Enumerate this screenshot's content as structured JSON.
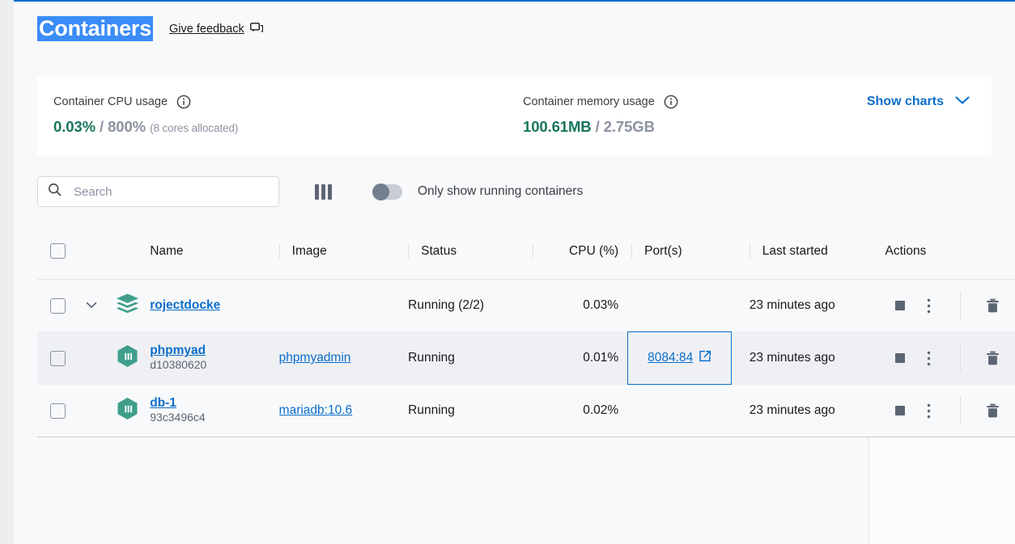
{
  "header": {
    "title": "Containers",
    "feedback_label": "Give feedback",
    "feedback_icon": "feedback-chat-icon"
  },
  "stats": {
    "cpu": {
      "label": "Container CPU usage",
      "info_icon": "info-icon",
      "used": "0.03%",
      "separator": " / ",
      "total": "800%",
      "note": "(8 cores allocated)"
    },
    "memory": {
      "label": "Container memory usage",
      "info_icon": "info-icon",
      "used": "100.61MB",
      "separator": " / ",
      "total": "2.75GB"
    },
    "show_charts_label": "Show charts",
    "show_charts_icon": "chevron-down-icon"
  },
  "toolbar": {
    "search_placeholder": "Search",
    "search_value": "",
    "search_icon": "search-icon",
    "columns_icon": "columns-icon",
    "toggle_label": "Only show running containers",
    "toggle_on": false
  },
  "table": {
    "columns": [
      {
        "key": "name",
        "label": "Name"
      },
      {
        "key": "image",
        "label": "Image"
      },
      {
        "key": "status",
        "label": "Status"
      },
      {
        "key": "cpu",
        "label": "CPU (%)"
      },
      {
        "key": "ports",
        "label": "Port(s)"
      },
      {
        "key": "last_started",
        "label": "Last started"
      },
      {
        "key": "actions",
        "label": "Actions"
      }
    ],
    "rows": [
      {
        "type": "group",
        "icon": "stack-icon",
        "expand_icon": "chevron-down-icon",
        "name": "rojectdocke",
        "id": "",
        "image": "",
        "status": "Running (2/2)",
        "cpu": "0.03%",
        "port": "",
        "port_icon": "",
        "last_started": "23 minutes ago",
        "selected": false,
        "highlighted": false,
        "port_focused": false
      },
      {
        "type": "container",
        "icon": "container-box-icon",
        "expand_icon": "",
        "name": "phpmyad",
        "id": "d10380620",
        "image": "phpmyadmin",
        "status": "Running",
        "cpu": "0.01%",
        "port": "8084:84",
        "port_icon": "external-link-icon",
        "last_started": "23 minutes ago",
        "selected": false,
        "highlighted": true,
        "port_focused": true
      },
      {
        "type": "container",
        "icon": "container-box-icon",
        "expand_icon": "",
        "name": "db-1",
        "id": "93c3496c4",
        "image": "mariadb:10.6",
        "status": "Running",
        "cpu": "0.02%",
        "port": "",
        "port_icon": "",
        "last_started": "23 minutes ago",
        "selected": false,
        "highlighted": false,
        "port_focused": false
      }
    ],
    "actions": {
      "stop_icon": "stop-icon",
      "menu_icon": "kebab-menu-icon",
      "delete_icon": "trash-icon"
    }
  },
  "colors": {
    "accent_blue": "#0b6ecb",
    "selection_blue": "#3a8cf7",
    "teal": "#17755d",
    "container_teal": "#3f9e8a",
    "slate": "#5c6573",
    "page_bg": "#f8f9fa",
    "row_hover": "#eff0f3"
  }
}
